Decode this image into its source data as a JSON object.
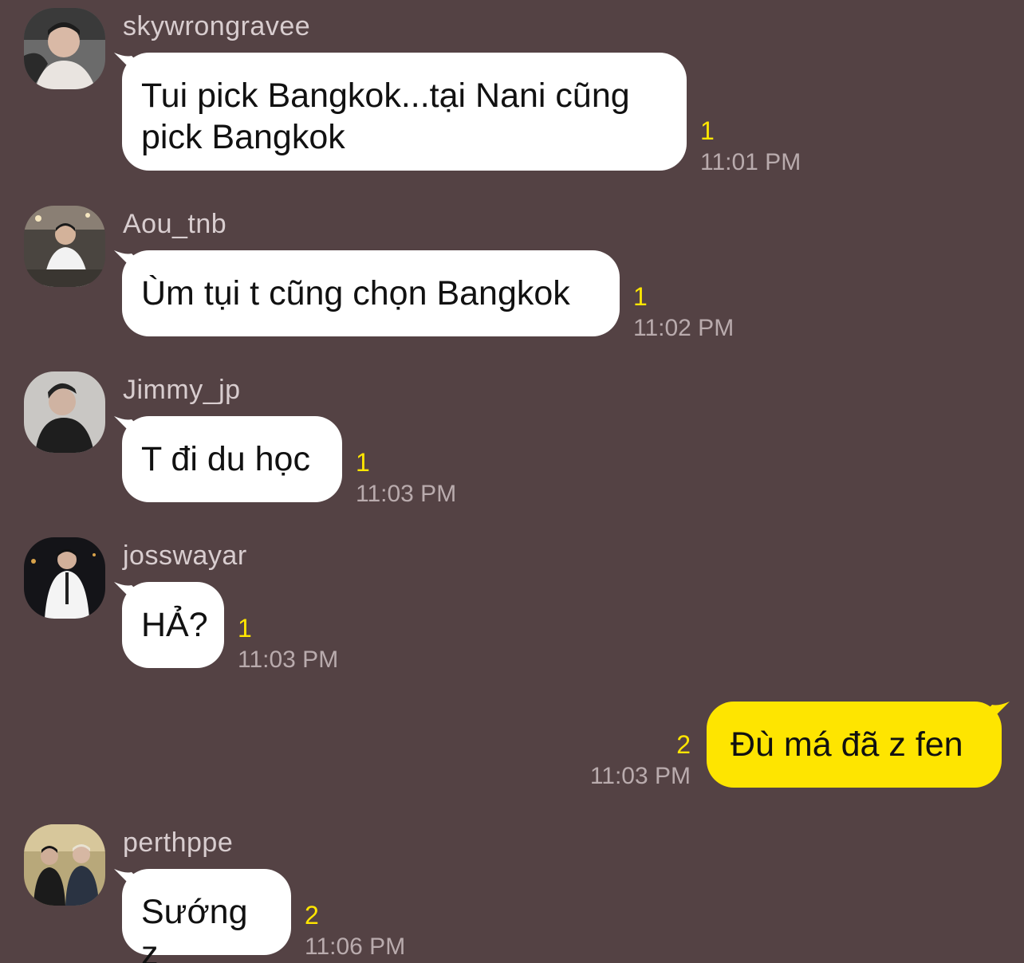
{
  "messages": [
    {
      "sender": "skywrongravee",
      "text": "Tui pick Bangkok...tại Nani cũng pick Bangkok",
      "unread": "1",
      "time": "11:01 PM"
    },
    {
      "sender": "Aou_tnb",
      "text": "Ùm tụi t cũng chọn Bangkok",
      "unread": "1",
      "time": "11:02 PM"
    },
    {
      "sender": "Jimmy_jp",
      "text": "T đi du học",
      "unread": "1",
      "time": "11:03 PM"
    },
    {
      "sender": "josswayar",
      "text": "HẢ?",
      "unread": "1",
      "time": "11:03 PM"
    },
    {
      "sender": "",
      "text": "Đù má đã z fen",
      "unread": "2",
      "time": "11:03 PM",
      "mine": true
    },
    {
      "sender": "perthppe",
      "text": "Sướng z",
      "unread": "2",
      "time": "11:06 PM"
    }
  ],
  "colors": {
    "background": "#544244",
    "bubble_other": "#ffffff",
    "bubble_mine": "#fee500",
    "unread": "#ffe600",
    "time": "#b9abad"
  }
}
